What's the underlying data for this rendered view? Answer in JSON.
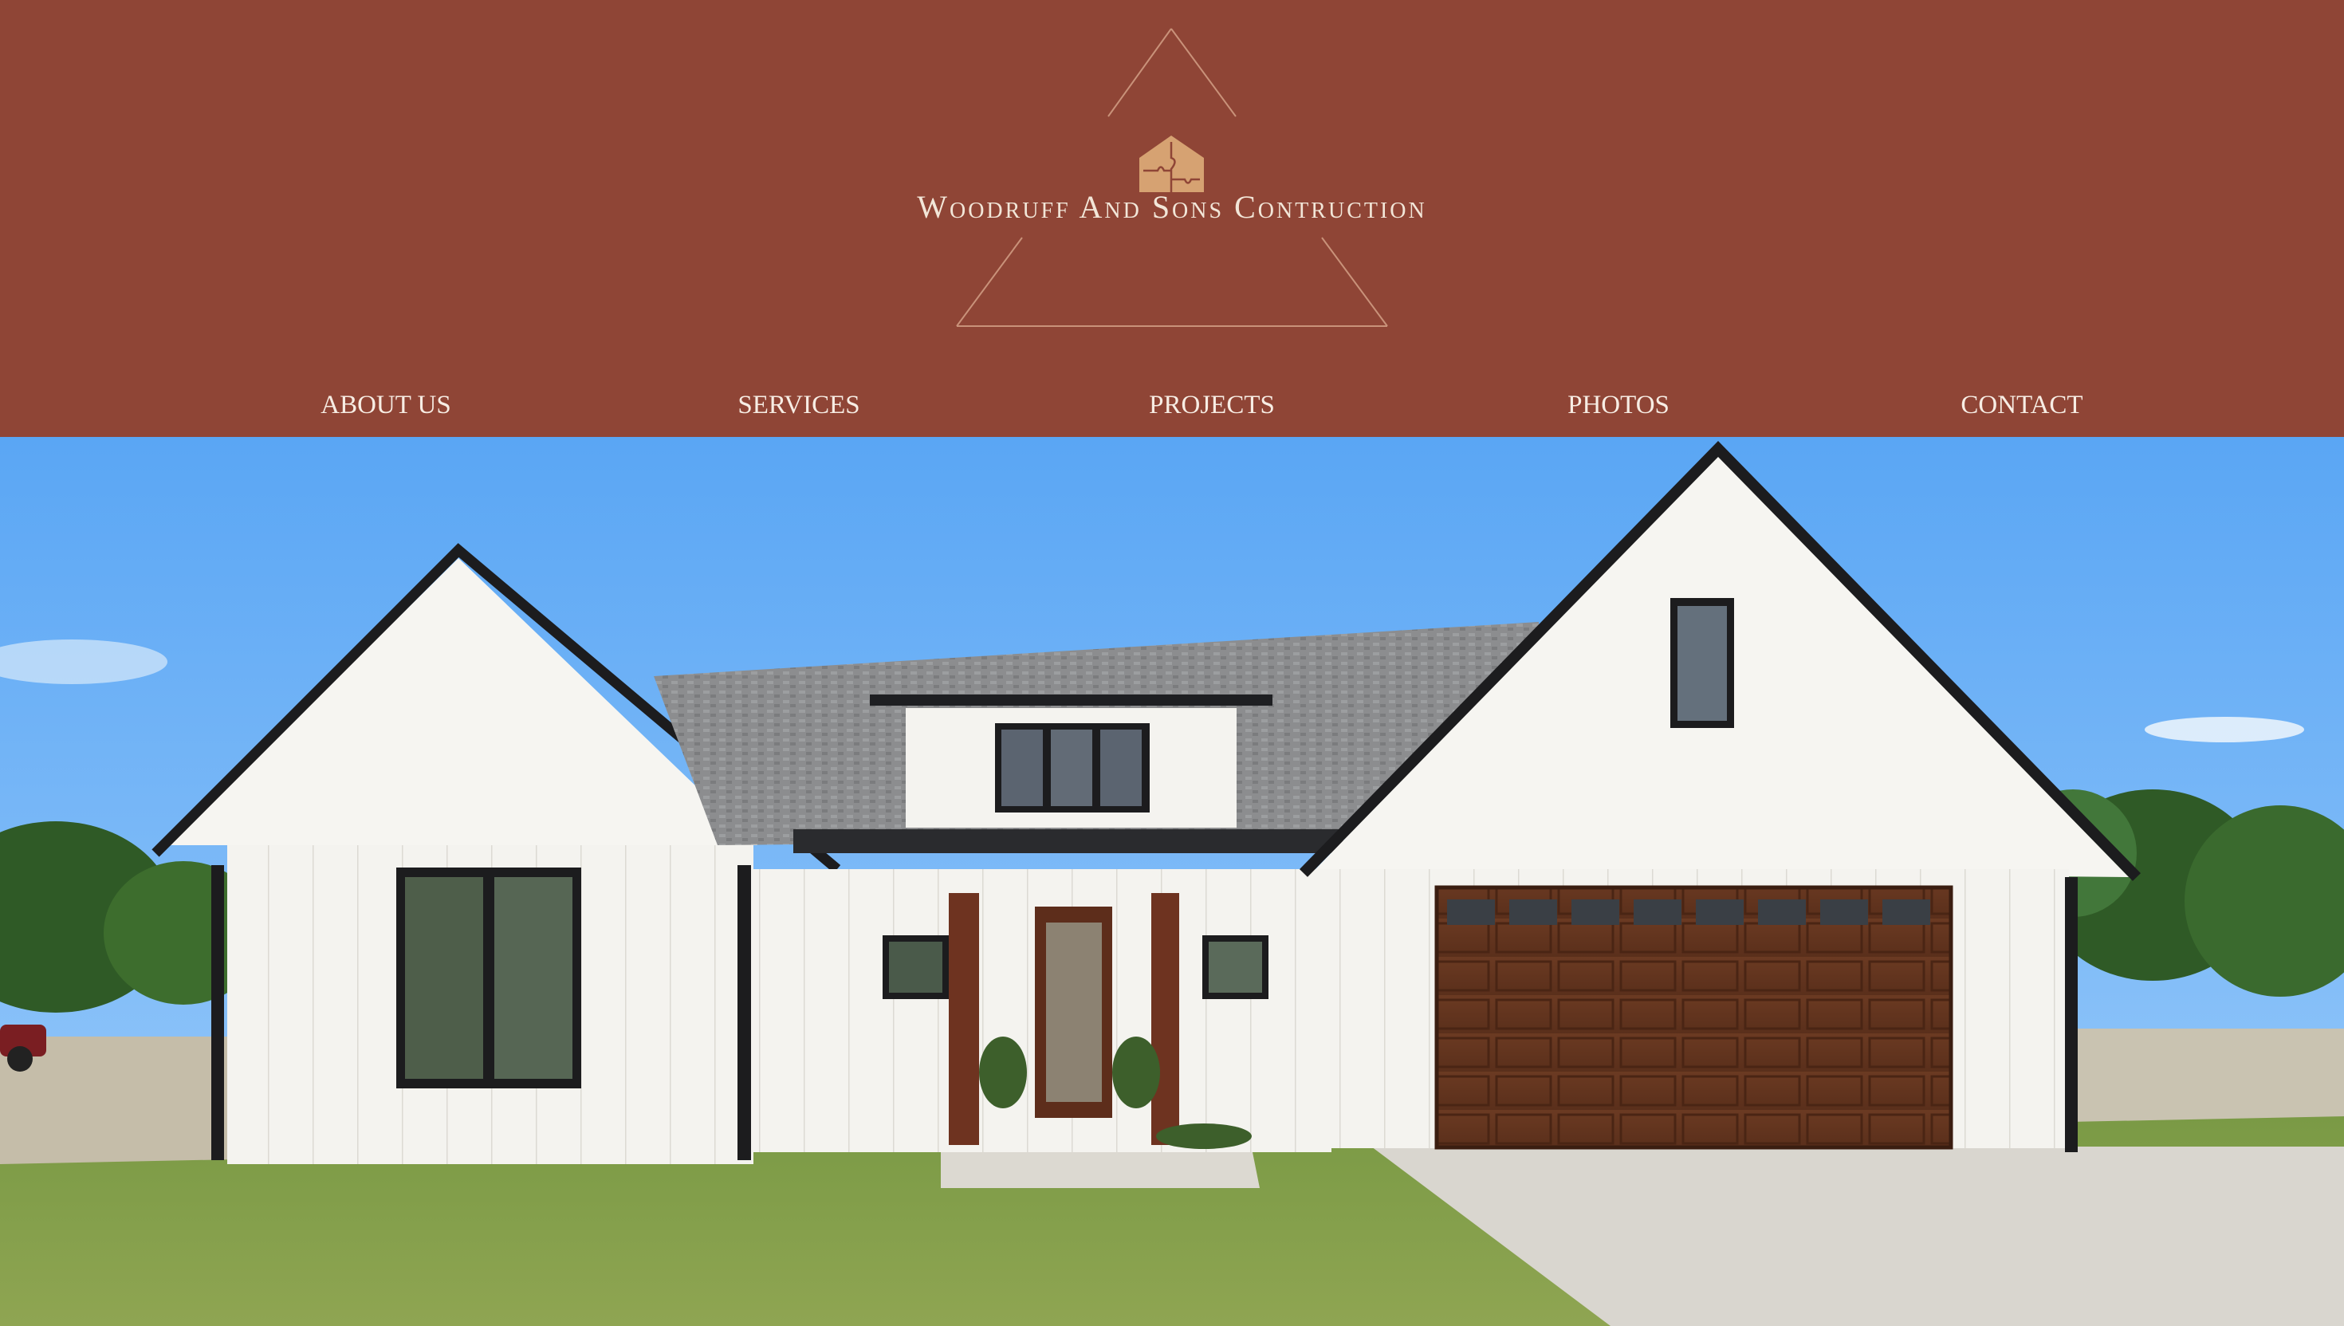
{
  "header": {
    "brand_name": "Woodruff And Sons Contruction",
    "logo_icon": "puzzle-house-icon",
    "background_color": "#8f4536",
    "logo_color": "#d6a272"
  },
  "nav": {
    "items": [
      {
        "label": "ABOUT US"
      },
      {
        "label": "SERVICES"
      },
      {
        "label": "PROJECTS"
      },
      {
        "label": "PHOTOS"
      },
      {
        "label": "CONTACT"
      }
    ]
  },
  "hero": {
    "image": "white-farmhouse-photo"
  }
}
